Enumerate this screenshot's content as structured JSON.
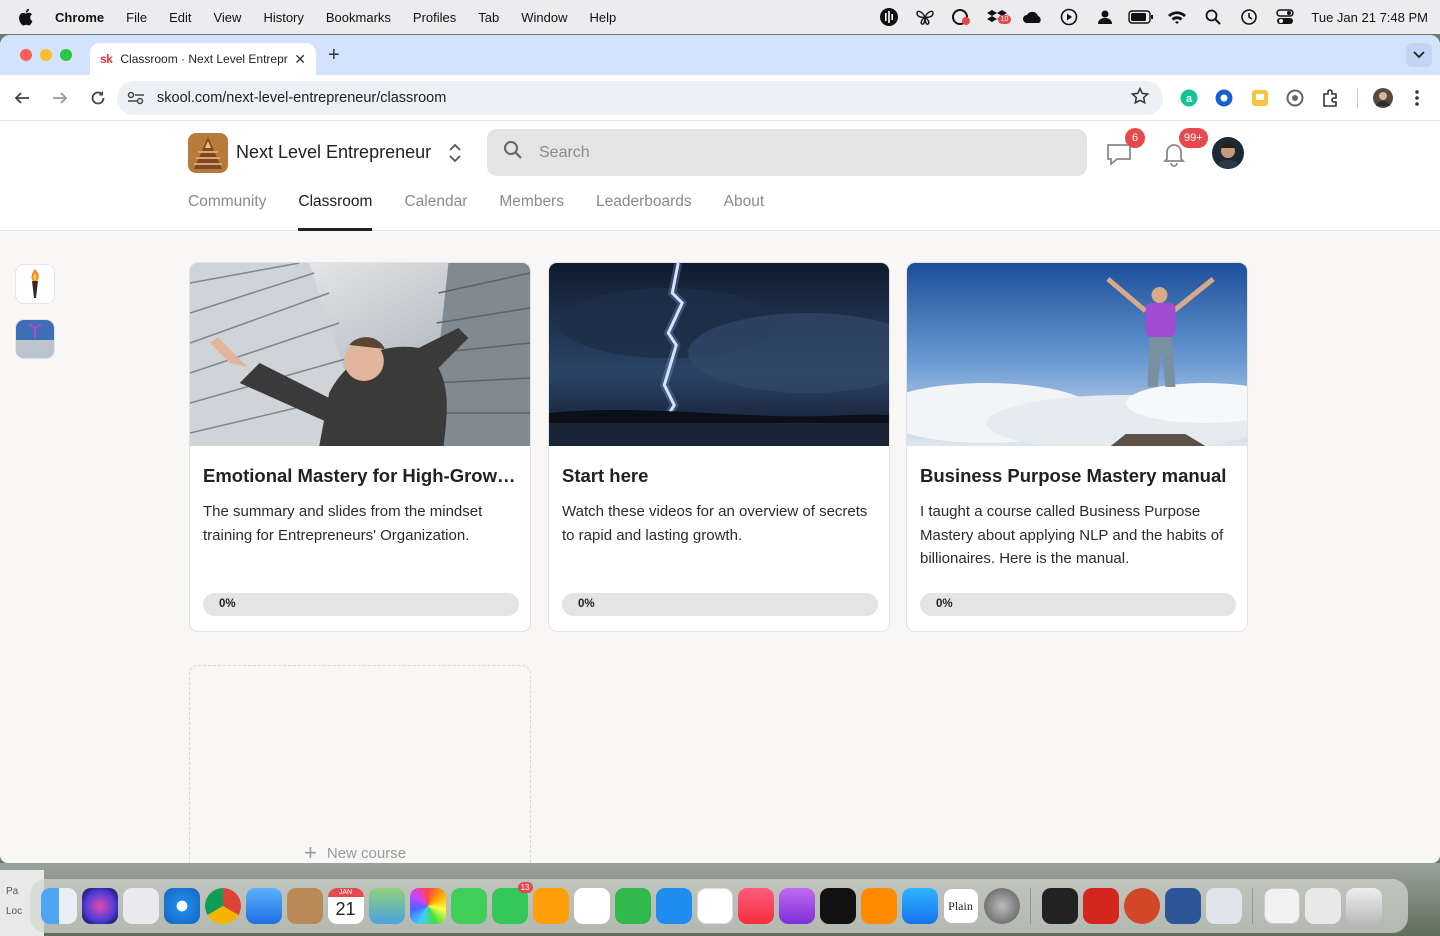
{
  "menubar": {
    "app_name": "Chrome",
    "menus": [
      "File",
      "Edit",
      "View",
      "History",
      "Bookmarks",
      "Profiles",
      "Tab",
      "Window",
      "Help"
    ],
    "clock": "Tue Jan 21  7:48 PM",
    "status_icons": [
      "audio-icon",
      "butterfly-icon",
      "cloud-sync-icon",
      "dropbox-icon",
      "cloud-icon",
      "play-icon",
      "user-icon",
      "battery-icon",
      "wifi-icon",
      "spotlight-icon",
      "time-machine-icon",
      "control-center-icon"
    ],
    "status_badge": "10"
  },
  "browser": {
    "tab_title": "Classroom · Next Level Entrepreneur",
    "tab_favicon": "sk",
    "url": "skool.com/next-level-entrepreneur/classroom"
  },
  "site": {
    "group_name": "Next Level Entrepreneur",
    "search_placeholder": "Search",
    "chat_badge": "6",
    "notifications_badge": "99+",
    "nav": [
      "Community",
      "Classroom",
      "Calendar",
      "Members",
      "Leaderboards",
      "About"
    ],
    "active_nav": "Classroom"
  },
  "courses": [
    {
      "title": "Emotional Mastery for High-Growth Entrepreneurs",
      "description": "The summary and slides from the mindset training for Entrepreneurs' Organization.",
      "progress_label": "0%",
      "progress": 0
    },
    {
      "title": "Start here",
      "description": "Watch these videos for an overview of secrets to rapid and lasting growth.",
      "progress_label": "0%",
      "progress": 0
    },
    {
      "title": "Business Purpose Mastery manual",
      "description": "I taught a course called Business Purpose Mastery about applying NLP and the habits of billionaires. Here is the manual.",
      "progress_label": "0%",
      "progress": 0
    }
  ],
  "new_course_label": "New course",
  "dock": {
    "calendar_month": "JAN",
    "calendar_day": "21",
    "facetime_badge": "13",
    "plain_label": "Plain",
    "left_peek": [
      "Pa",
      "Loc"
    ]
  },
  "colors": {
    "accent": "#202124",
    "badge": "#e5484d",
    "tabstrip": "#d3e3fd",
    "progress_track": "#e4e4e4"
  }
}
